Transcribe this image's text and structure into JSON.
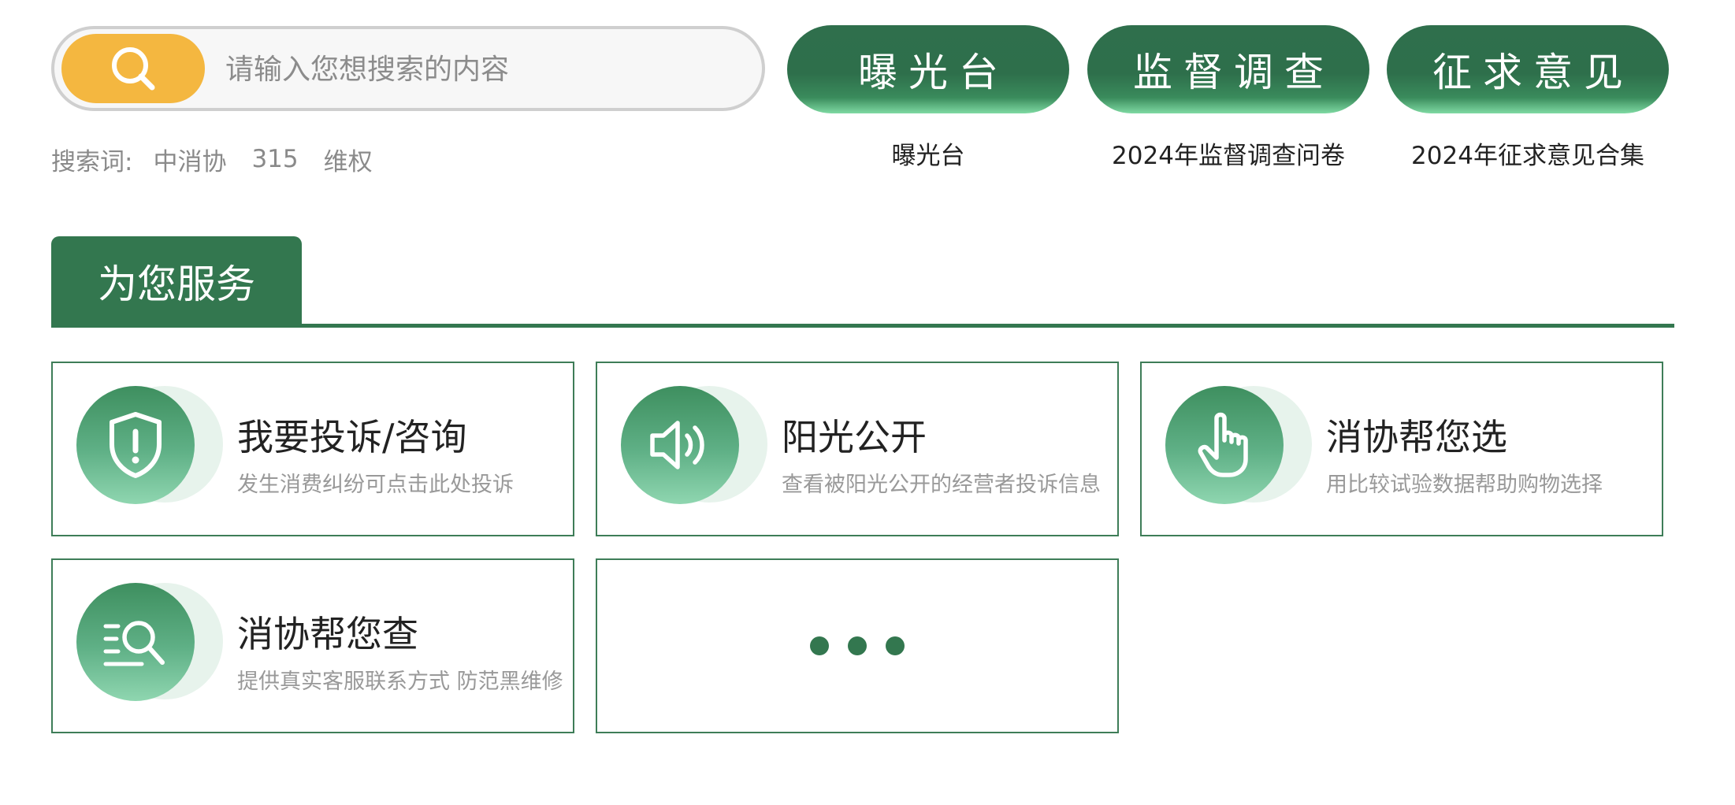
{
  "search": {
    "placeholder": "请输入您想搜索的内容",
    "value": ""
  },
  "hot_search": {
    "label": "搜索词:",
    "keywords": [
      "中消协",
      "315",
      "维权"
    ]
  },
  "quick_links": [
    {
      "label": "曝光台",
      "caption": "曝光台"
    },
    {
      "label": "监督调查",
      "caption": "2024年监督调查问卷"
    },
    {
      "label": "征求意见",
      "caption": "2024年征求意见合集"
    }
  ],
  "section": {
    "title": "为您服务"
  },
  "services": [
    {
      "title": "我要投诉/咨询",
      "desc": "发生消费纠纷可点击此处投诉",
      "icon": "shield-alert-icon"
    },
    {
      "title": "阳光公开",
      "desc": "查看被阳光公开的经营者投诉信息",
      "icon": "speaker-icon"
    },
    {
      "title": "消协帮您选",
      "desc": "用比较试验数据帮助购物选择",
      "icon": "pointing-hand-icon"
    },
    {
      "title": "消协帮您查",
      "desc": "提供真实客服联系方式 防范黑维修",
      "icon": "list-search-icon"
    }
  ],
  "more": {
    "icon": "more-dots-icon"
  },
  "colors": {
    "brand_green": "#33774f",
    "search_button": "#f4b740",
    "muted_text": "#8a8a8a"
  }
}
